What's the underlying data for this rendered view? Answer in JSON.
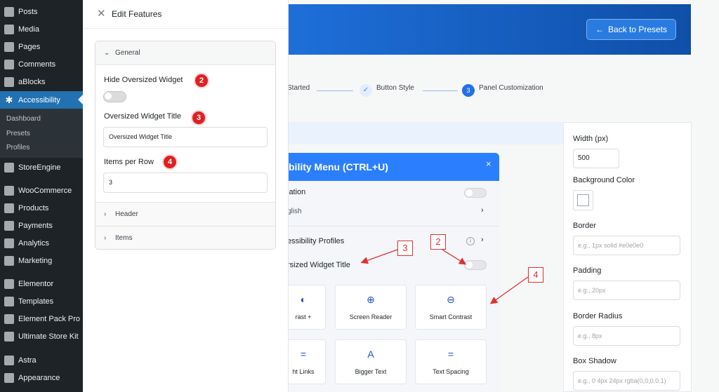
{
  "sidebar": {
    "items": [
      {
        "label": "Posts",
        "icon": "pin-icon"
      },
      {
        "label": "Media",
        "icon": "media-icon"
      },
      {
        "label": "Pages",
        "icon": "pages-icon"
      },
      {
        "label": "Comments",
        "icon": "comments-icon"
      },
      {
        "label": "aBlocks",
        "icon": "ablocks-icon"
      },
      {
        "label": "Accessibility",
        "icon": "accessibility-icon",
        "active": true
      },
      {
        "label": "StoreEngine",
        "icon": "storeengine-icon"
      },
      {
        "label": "WooCommerce",
        "icon": "woocommerce-icon"
      },
      {
        "label": "Products",
        "icon": "products-icon"
      },
      {
        "label": "Payments",
        "icon": "payments-icon"
      },
      {
        "label": "Analytics",
        "icon": "analytics-icon"
      },
      {
        "label": "Marketing",
        "icon": "marketing-icon"
      },
      {
        "label": "Elementor",
        "icon": "elementor-icon"
      },
      {
        "label": "Templates",
        "icon": "templates-icon"
      },
      {
        "label": "Element Pack Pro",
        "icon": "element-pack-icon"
      },
      {
        "label": "Ultimate Store Kit",
        "icon": "store-kit-icon"
      },
      {
        "label": "Astra",
        "icon": "astra-icon"
      },
      {
        "label": "Appearance",
        "icon": "appearance-icon"
      }
    ],
    "submenu": [
      "Dashboard",
      "Presets",
      "Profiles"
    ]
  },
  "header": {
    "back_label": "Back to Presets"
  },
  "steps": {
    "step1": "Started",
    "step2": "Button Style",
    "step3_num": "3",
    "step3": "Panel Customization"
  },
  "drawer": {
    "title": "Edit Features",
    "general": "General",
    "hide_label": "Hide Oversized Widget",
    "title_label": "Oversized Widget Title",
    "title_value": "Oversized Widget Title",
    "items_label": "Items per Row",
    "items_value": "3",
    "header": "Header",
    "items": "Items"
  },
  "widget": {
    "title": "bility Menu (CTRL+U)",
    "close": "×",
    "row_lang": "lation",
    "row_lang_val": "glish",
    "row_profiles": "essibility Profiles",
    "row_oversized": "rsized Widget Title",
    "tiles": [
      {
        "label": "rast +",
        "icon": "contrast-icon"
      },
      {
        "label": "Screen Reader",
        "icon": "screen-reader-icon"
      },
      {
        "label": "Smart Contrast",
        "icon": "smart-contrast-icon"
      },
      {
        "label": "ht Links",
        "icon": "links-icon"
      },
      {
        "label": "Bigger Text",
        "icon": "bigger-text-icon"
      },
      {
        "label": "Text Spacing",
        "icon": "text-spacing-icon"
      }
    ]
  },
  "settings": {
    "width_label": "Width (px)",
    "width_value": "500",
    "bg_label": "Background Color",
    "border_label": "Border",
    "border_ph": "e.g., 1px solid #e0e0e0",
    "padding_label": "Padding",
    "padding_ph": "e.g., 20px",
    "radius_label": "Border Radius",
    "radius_ph": "e.g., 8px",
    "shadow_label": "Box Shadow",
    "shadow_ph": "e.g., 0 4px 24px rgba(0,0,0,0.1)"
  },
  "annotations": {
    "badge2": "2",
    "badge3": "3",
    "badge4": "4",
    "callout3": "3",
    "callout2": "2",
    "callout4": "4"
  },
  "colors": {
    "accent": "#2271b1",
    "badge": "#e02020",
    "widget_header": "#2a7fff"
  }
}
